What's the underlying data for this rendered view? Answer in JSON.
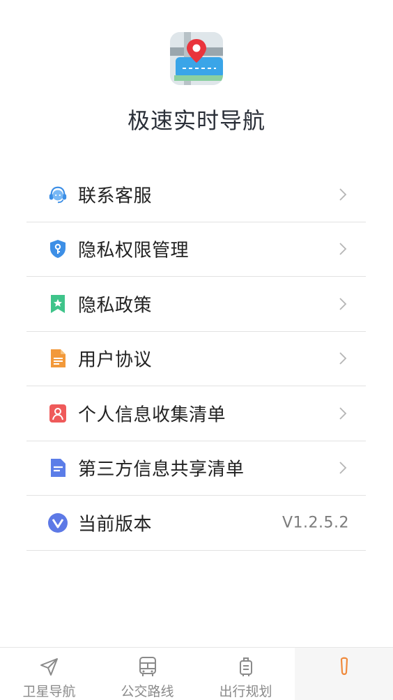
{
  "app": {
    "name": "极速实时导航"
  },
  "menu": {
    "items": [
      {
        "label": "联系客服",
        "icon": "headset-icon"
      },
      {
        "label": "隐私权限管理",
        "icon": "shield-key-icon"
      },
      {
        "label": "隐私政策",
        "icon": "bookmark-star-icon"
      },
      {
        "label": "用户协议",
        "icon": "document-icon"
      },
      {
        "label": "个人信息收集清单",
        "icon": "user-card-icon"
      },
      {
        "label": "第三方信息共享清单",
        "icon": "file-lines-icon"
      },
      {
        "label": "当前版本",
        "icon": "version-v-icon",
        "value": "V1.2.5.2"
      }
    ]
  },
  "tabbar": {
    "tabs": [
      {
        "label": "卫星导航",
        "icon": "navigation-arrow-icon"
      },
      {
        "label": "公交路线",
        "icon": "bus-icon"
      },
      {
        "label": "出行规划",
        "icon": "suitcase-icon"
      },
      {
        "label": "",
        "icon": "profile-icon",
        "active": true
      }
    ]
  },
  "colors": {
    "active_tab": "#f08a3c",
    "inactive_tab": "#8a8a8a",
    "headset": "#3d8fe6",
    "shield": "#3d8fe6",
    "bookmark": "#3fc48a",
    "document": "#f2993a",
    "user_card": "#ef5a5a",
    "file": "#5b7de8",
    "version": "#5d79e6"
  }
}
